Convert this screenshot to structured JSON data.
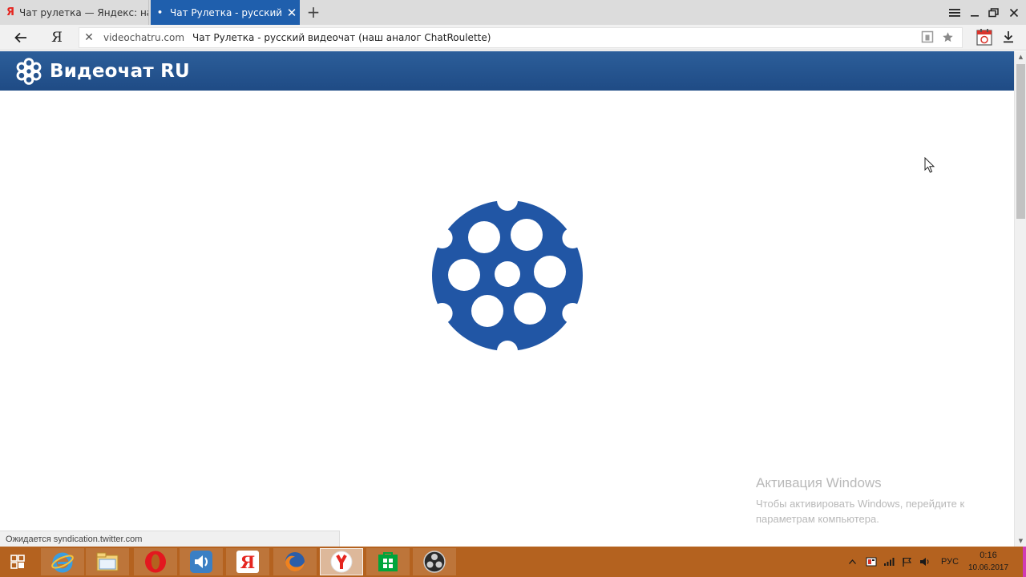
{
  "browser": {
    "tabs": [
      {
        "favicon": "Я",
        "title": "Чат рулетка — Яндекс: наш"
      },
      {
        "favicon": "•",
        "title": "Чат Рулетка - русский ви",
        "close": "✕"
      }
    ],
    "new_tab": "+",
    "yandex_button": "Я",
    "address": {
      "stop": "✕",
      "domain": "videochatru.com",
      "page_title": "Чат Рулетка - русский видеочат (наш аналог ChatRoulette)"
    },
    "status_text": "Ожидается syndication.twitter.com"
  },
  "site": {
    "brand": "Видеочат RU",
    "accent": "#2156a5"
  },
  "watermark": {
    "title": "Активация Windows",
    "line1": "Чтобы активировать Windows, перейдите к",
    "line2": "параметрам компьютера."
  },
  "taskbar": {
    "apps": [
      "start-icon",
      "internet-explorer-icon",
      "file-explorer-icon",
      "opera-icon",
      "speaker-app-icon",
      "yandex-icon",
      "firefox-icon",
      "yandex-browser-icon",
      "store-icon",
      "obs-icon"
    ],
    "language": "РУС",
    "time": "0:16",
    "date": "10.06.2017"
  }
}
